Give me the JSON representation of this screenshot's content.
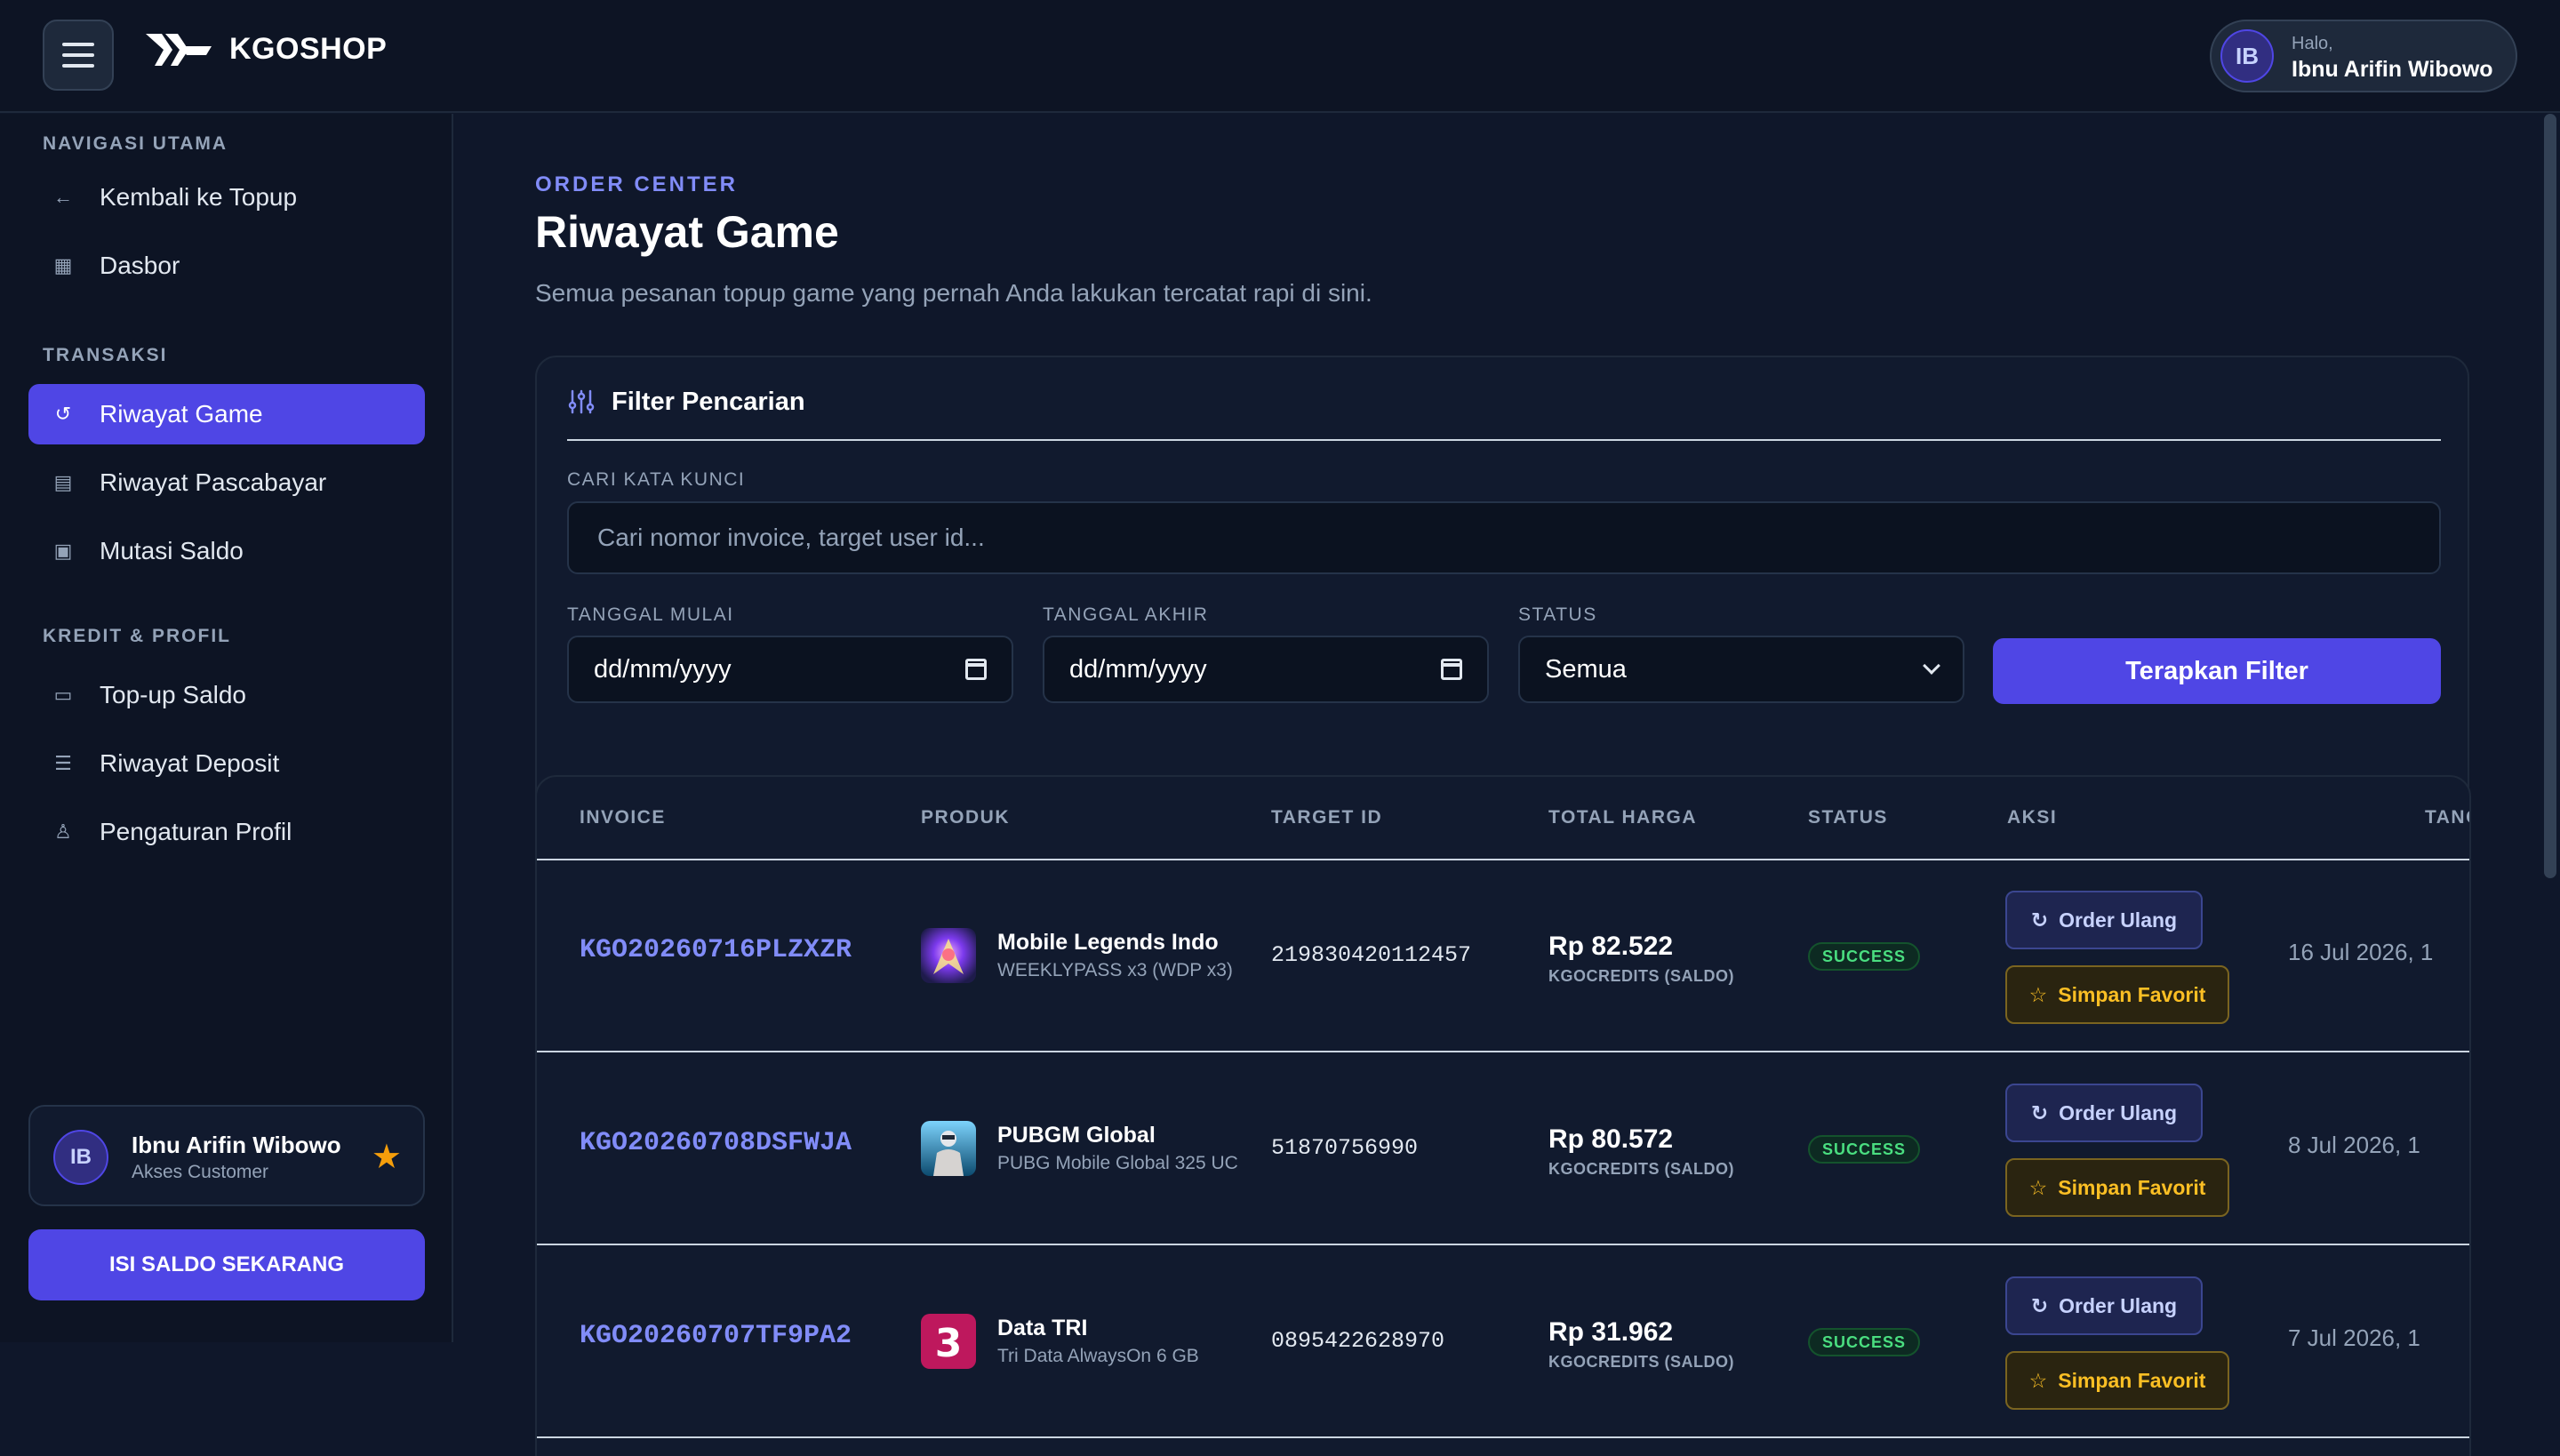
{
  "header": {
    "brand": "KGOSHOP",
    "greeting": "Halo,",
    "user_name": "Ibnu Arifin Wibowo",
    "user_initials": "IB"
  },
  "sidebar": {
    "sections": [
      {
        "title": "NAVIGASI UTAMA",
        "items": [
          {
            "label": "Kembali ke Topup",
            "icon": "arrow-left-icon",
            "glyph": "←"
          },
          {
            "label": "Dasbor",
            "icon": "grid-icon",
            "glyph": "▦"
          }
        ]
      },
      {
        "title": "TRANSAKSI",
        "items": [
          {
            "label": "Riwayat Game",
            "icon": "history-icon",
            "glyph": "↺",
            "active": true
          },
          {
            "label": "Riwayat Pascabayar",
            "icon": "receipt-icon",
            "glyph": "▤"
          },
          {
            "label": "Mutasi Saldo",
            "icon": "calendar-icon",
            "glyph": "▣"
          }
        ]
      },
      {
        "title": "KREDIT & PROFIL",
        "items": [
          {
            "label": "Top-up Saldo",
            "icon": "wallet-icon",
            "glyph": "▭"
          },
          {
            "label": "Riwayat Deposit",
            "icon": "list-icon",
            "glyph": "☰"
          },
          {
            "label": "Pengaturan Profil",
            "icon": "user-icon",
            "glyph": "♙"
          }
        ]
      }
    ],
    "profile": {
      "initials": "IB",
      "name": "Ibnu Arifin Wibowo",
      "role": "Akses Customer"
    },
    "topup_button": "ISI SALDO SEKARANG"
  },
  "main": {
    "eyebrow": "ORDER CENTER",
    "title": "Riwayat Game",
    "subtitle": "Semua pesanan topup game yang pernah Anda lakukan tercatat rapi di sini.",
    "filter": {
      "title": "Filter Pencarian",
      "keyword_label": "CARI KATA KUNCI",
      "keyword_placeholder": "Cari nomor invoice, target user id...",
      "start_label": "TANGGAL MULAI",
      "start_value": "dd/mm/yyyy",
      "end_label": "TANGGAL AKHIR",
      "end_value": "dd/mm/yyyy",
      "status_label": "STATUS",
      "status_value": "Semua",
      "apply_button": "Terapkan Filter"
    },
    "table": {
      "columns": [
        "INVOICE",
        "PRODUK",
        "TARGET ID",
        "TOTAL HARGA",
        "STATUS",
        "AKSI",
        "TANG"
      ],
      "rows": [
        {
          "invoice": "KGO20260716PLZXZR",
          "product": "Mobile Legends Indo",
          "variant": "WEEKLYPASS x3 (WDP x3)",
          "target_id": "219830420112457",
          "price": "Rp 82.522",
          "payment": "KGOCREDITS (SALDO)",
          "status": "SUCCESS",
          "reorder": "Order Ulang",
          "favorite": "Simpan Favorit",
          "date": "16 Jul 2026, 1"
        },
        {
          "invoice": "KGO20260708DSFWJA",
          "product": "PUBGM Global",
          "variant": "PUBG Mobile Global 325 UC",
          "target_id": "51870756990",
          "price": "Rp 80.572",
          "payment": "KGOCREDITS (SALDO)",
          "status": "SUCCESS",
          "reorder": "Order Ulang",
          "favorite": "Simpan Favorit",
          "date": "8 Jul 2026, 1"
        },
        {
          "invoice": "KGO20260707TF9PA2",
          "product": "Data TRI",
          "variant": "Tri Data AlwaysOn 6 GB",
          "target_id": "0895422628970",
          "price": "Rp 31.962",
          "payment": "KGOCREDITS (SALDO)",
          "status": "SUCCESS",
          "reorder": "Order Ulang",
          "favorite": "Simpan Favorit",
          "date": "7 Jul 2026, 1"
        }
      ]
    }
  },
  "colors": {
    "accent": "#4f46e5",
    "success": "#4ade80",
    "favorite": "#fbbf24",
    "background": "#0f172a"
  }
}
